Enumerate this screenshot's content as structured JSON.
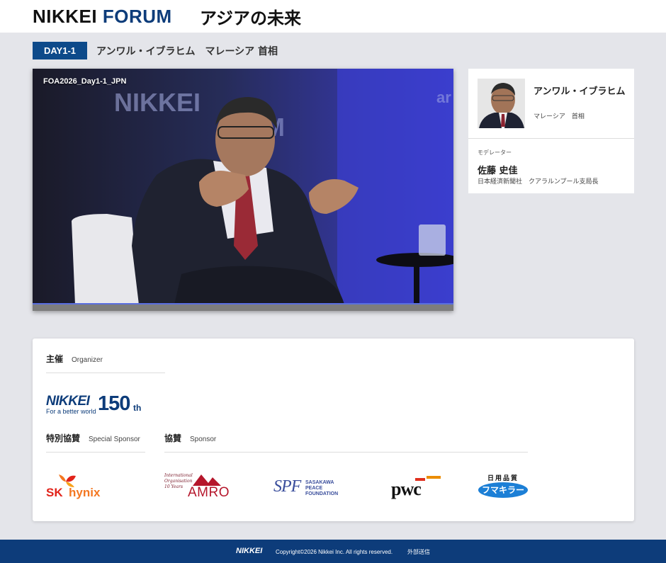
{
  "header": {
    "brand_left": "NIKKEI ",
    "brand_right": "FORUM",
    "tagline": "アジアの未来"
  },
  "session": {
    "day_badge": "DAY1-1",
    "title": "アンワル・イブラヒム　マレーシア 首相"
  },
  "video": {
    "label": "FOA2026_Day1-1_JPN"
  },
  "speaker": {
    "name": "アンワル・イブラヒム",
    "role": "マレーシア　首相"
  },
  "moderator": {
    "label": "モデレーター",
    "name": "佐藤 史佳",
    "org": "日本経済新聞社　クアラルンプール支局長"
  },
  "sponsors": {
    "organizer": {
      "jp": "主催",
      "en": "Organizer"
    },
    "special": {
      "jp": "特別協賛",
      "en": "Special Sponsor"
    },
    "sponsor": {
      "jp": "協賛",
      "en": "Sponsor"
    },
    "logos": {
      "nikkei_word": "NIKKEI",
      "nikkei_sub": "For a better world",
      "nikkei_150": "150",
      "nikkei_th": "th",
      "sk": "SK",
      "hynix": "hynix",
      "amro": "AMRO",
      "amro_script": "International Organisation 10 Years",
      "spf_mark": "SPF",
      "spf_line1": "SASAKAWA",
      "spf_line2": "PEACE",
      "spf_line3": "FOUNDATION",
      "pwc": "pwc",
      "fk_top": "日用品質",
      "fk_main": "フマキラー"
    }
  },
  "footer": {
    "logo": "NIKKEI",
    "copyright": "Copyright©2026 Nikkei Inc. All rights reserved.",
    "link": "外部送信"
  },
  "colors": {
    "brand_navy": "#0d3c7a",
    "badge_blue": "#0d4a8a",
    "page_bg": "#e4e5ea"
  }
}
